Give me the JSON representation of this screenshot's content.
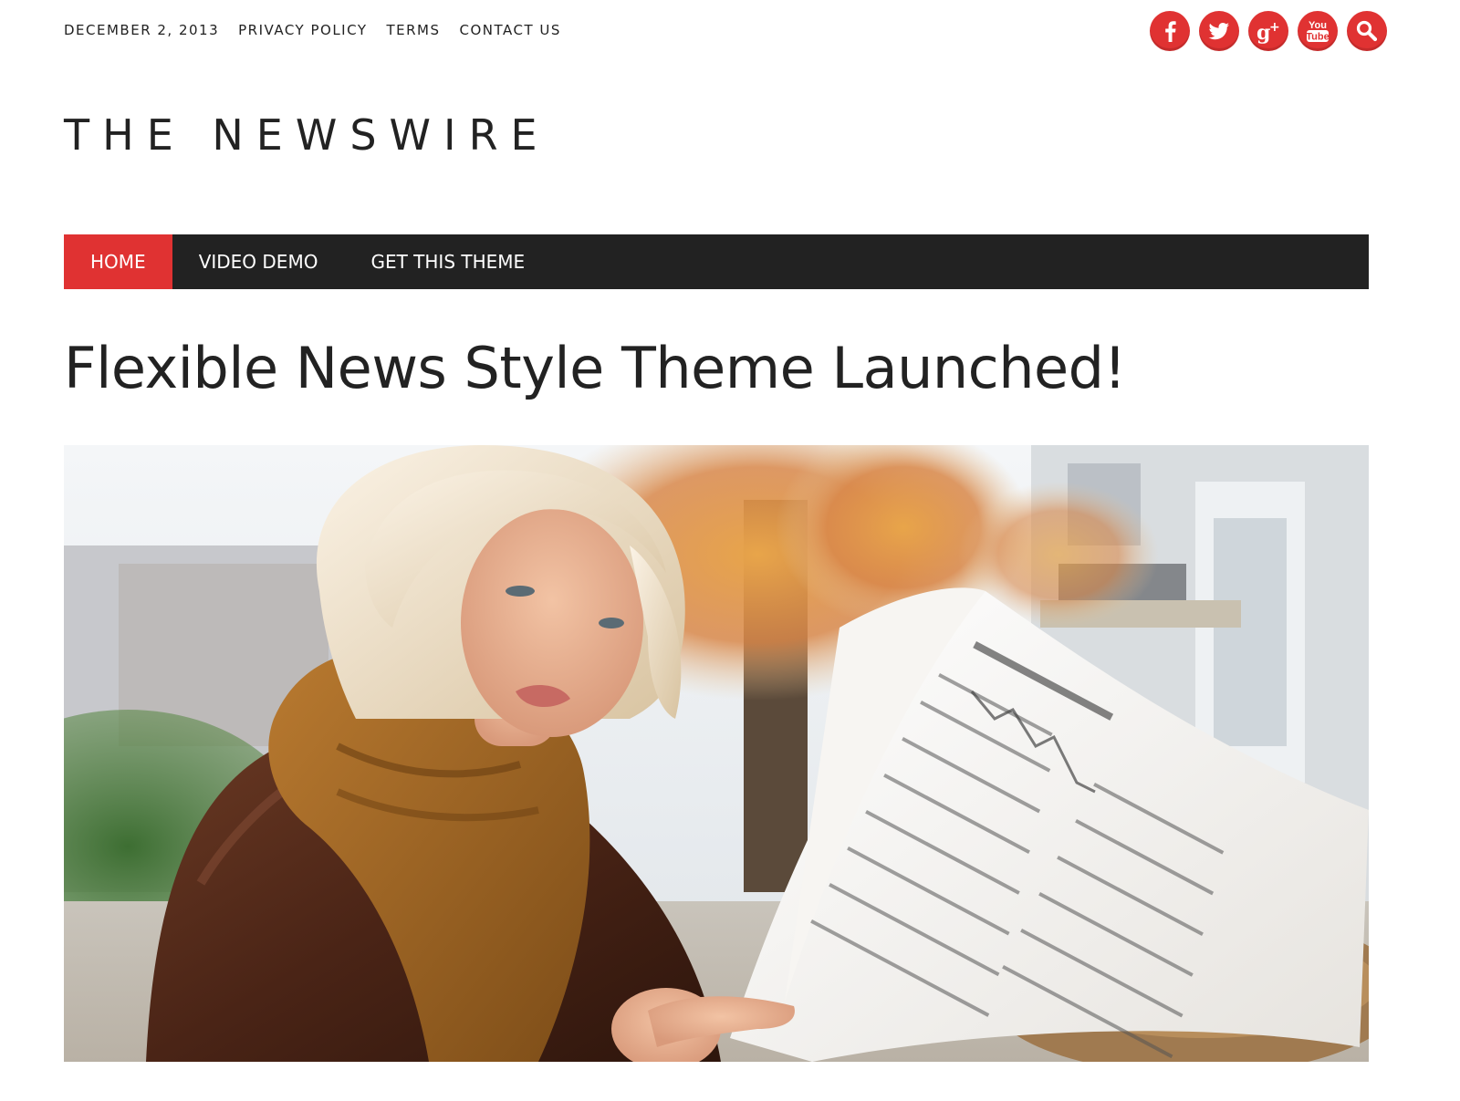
{
  "topbar": {
    "date": "December 2, 2013",
    "links": [
      "Privacy Policy",
      "Terms",
      "Contact Us"
    ]
  },
  "social": [
    {
      "name": "facebook-icon",
      "glyph": "f"
    },
    {
      "name": "twitter-icon",
      "glyph": "bird"
    },
    {
      "name": "google-plus-icon",
      "glyph": "g+"
    },
    {
      "name": "youtube-icon",
      "glyph_top": "You",
      "glyph_bottom": "Tube"
    },
    {
      "name": "search-icon",
      "glyph": "magnifier"
    }
  ],
  "site": {
    "title": "THE NEWSWIRE"
  },
  "nav": {
    "items": [
      "Home",
      "Video Demo",
      "Get This Theme"
    ],
    "active_index": 0
  },
  "article": {
    "headline": "Flexible News Style Theme Launched!",
    "image_subject": "photo-woman-reading-newspaper"
  },
  "colors": {
    "accent": "#e03232",
    "nav_bg": "#222222",
    "text": "#222222",
    "background": "#ffffff"
  }
}
